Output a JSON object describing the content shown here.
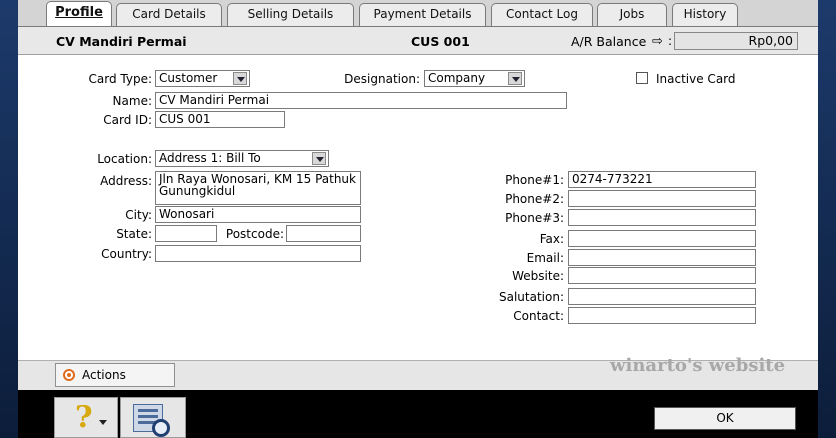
{
  "tabs": [
    {
      "label": "Profile",
      "active": true
    },
    {
      "label": "Card Details"
    },
    {
      "label": "Selling Details"
    },
    {
      "label": "Payment Details"
    },
    {
      "label": "Contact Log"
    },
    {
      "label": "Jobs"
    },
    {
      "label": "History"
    }
  ],
  "header": {
    "name": "CV Mandiri Permai",
    "card_id": "CUS  001",
    "balance_label": "A/R Balance",
    "balance_value": "Rp0,00"
  },
  "form": {
    "card_type_label": "Card Type:",
    "card_type_value": "Customer",
    "designation_label": "Designation:",
    "designation_value": "Company",
    "inactive_label": "Inactive Card",
    "name_label": "Name:",
    "name_value": "CV Mandiri Permai",
    "card_id_label": "Card ID:",
    "card_id_value": "CUS  001",
    "location_label": "Location:",
    "location_value": "Address 1:  Bill To",
    "address_label": "Address:",
    "address_value": "Jln Raya Wonosari, KM 15 Pathuk Gunungkidul",
    "city_label": "City:",
    "city_value": "Wonosari",
    "state_label": "State:",
    "state_value": "",
    "postcode_label": "Postcode:",
    "postcode_value": "",
    "country_label": "Country:",
    "country_value": ""
  },
  "contact": {
    "phone1_label": "Phone#1:",
    "phone1_value": "0274-773221",
    "phone2_label": "Phone#2:",
    "phone2_value": "",
    "phone3_label": "Phone#3:",
    "phone3_value": "",
    "fax_label": "Fax:",
    "fax_value": "",
    "email_label": "Email:",
    "email_value": "",
    "website_label": "Website:",
    "website_value": "",
    "salutation_label": "Salutation:",
    "salutation_value": "",
    "contact_label": "Contact:",
    "contact_value": ""
  },
  "footer": {
    "actions_label": "Actions",
    "watermark": "winarto's website",
    "ok_label": "OK"
  },
  "icons": {
    "help": "help-question-icon",
    "view": "view-details-icon",
    "actions": "actions-circle-icon",
    "balance_arrow": "arrow-right-icon"
  }
}
